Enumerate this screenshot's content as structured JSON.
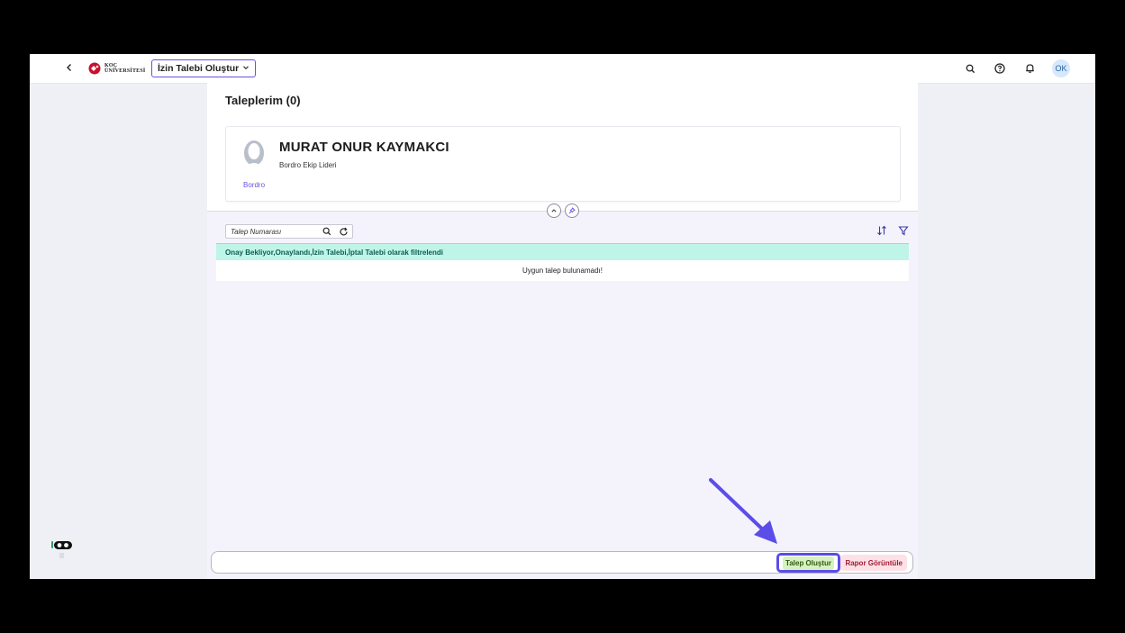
{
  "shell": {
    "logo_text_line1": "KOÇ",
    "logo_text_line2": "ÜNİVERSİTESİ",
    "app_title": "İzin Talebi Oluştur",
    "avatar_initials": "OK",
    "icons": [
      "back-icon",
      "search-icon",
      "help-icon",
      "bell-icon"
    ]
  },
  "page": {
    "title": "Taleplerim (0)",
    "profile": {
      "name": "MURAT ONUR KAYMAKCI",
      "role": "Bordro Ekip Lideri",
      "department": "Bordro"
    }
  },
  "list": {
    "search_placeholder": "Talep Numarası",
    "filter_text": "Onay Bekliyor,Onaylandı,İzin Talebi,İptal Talebi olarak filtrelendi",
    "empty_text": "Uygun talep bulunamadı!"
  },
  "footer": {
    "create_label": "Talep Oluştur",
    "report_label": "Rapor Görüntüle"
  },
  "colors": {
    "accent": "#5b4de8",
    "filter_bg": "#bff5e8",
    "create_bg": "#d7f1c0",
    "report_bg": "#fde1e6",
    "arrow": "#5b4de8"
  }
}
